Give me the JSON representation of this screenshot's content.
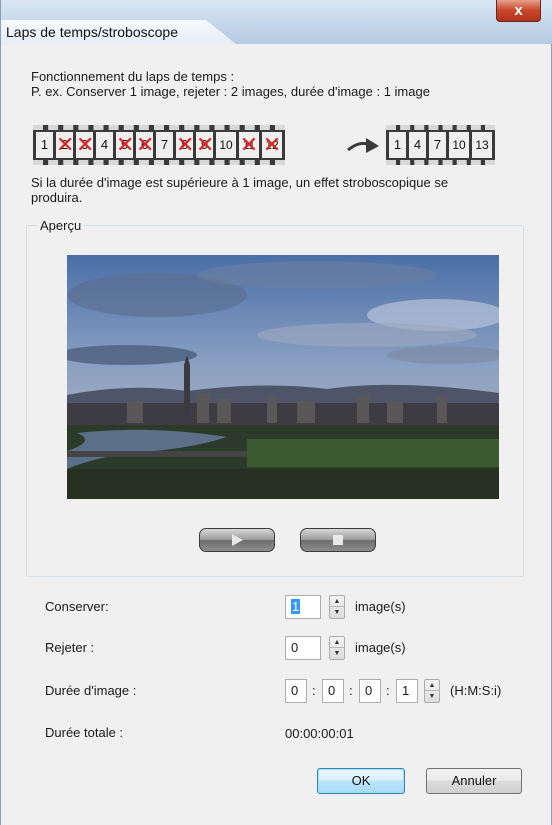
{
  "window": {
    "title": "Laps de temps/stroboscope",
    "close_glyph": "x"
  },
  "description": {
    "line1": "Fonctionnement du laps de temps :",
    "line2": "P. ex. Conserver 1 image, rejeter : 2 images, durée d'image : 1 image"
  },
  "film_before": [
    {
      "n": "1",
      "x": false
    },
    {
      "n": "2",
      "x": true
    },
    {
      "n": "3",
      "x": true
    },
    {
      "n": "4",
      "x": false
    },
    {
      "n": "5",
      "x": true
    },
    {
      "n": "6",
      "x": true
    },
    {
      "n": "7",
      "x": false
    },
    {
      "n": "8",
      "x": true
    },
    {
      "n": "9",
      "x": true
    },
    {
      "n": "10",
      "x": false
    },
    {
      "n": "11",
      "x": true
    },
    {
      "n": "12",
      "x": true
    }
  ],
  "film_after": [
    "1",
    "4",
    "7",
    "10",
    "13"
  ],
  "strobe_note": {
    "line1": "Si la durée d'image est supérieure à 1 image, un effet stroboscopique se",
    "line2": "produira."
  },
  "preview": {
    "group_label": "Aperçu",
    "play_icon": "play-icon",
    "stop_icon": "stop-icon"
  },
  "fields": {
    "keep_label": "Conserver:",
    "keep_value": "1",
    "keep_unit": "image(s)",
    "drop_label": "Rejeter :",
    "drop_value": "0",
    "drop_unit": "image(s)",
    "duration_label": "Durée d'image :",
    "duration_h": "0",
    "duration_m": "0",
    "duration_s": "0",
    "duration_i": "1",
    "duration_unit": "(H:M:S:i)",
    "total_label": "Durée totale :",
    "total_value": "00:00:00:01"
  },
  "buttons": {
    "ok": "OK",
    "cancel": "Annuler"
  },
  "colors": {
    "default_button_border": "#3c7fb1",
    "selection": "#3399ff",
    "close_button": "#c8452a"
  }
}
